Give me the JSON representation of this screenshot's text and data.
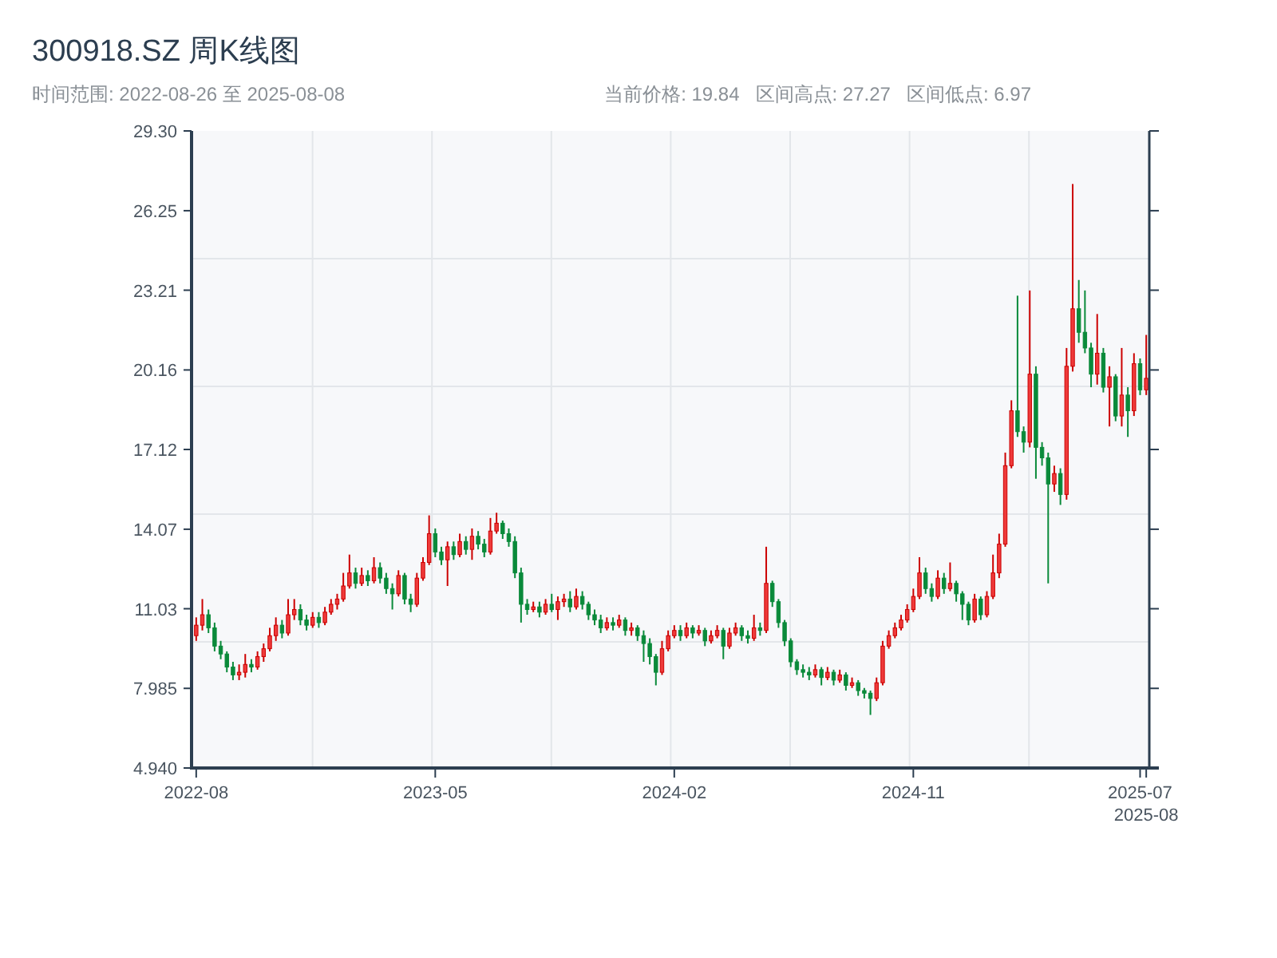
{
  "title": "300918.SZ 周K线图",
  "range_text": "时间范围: 2022-08-26 至 2025-08-08",
  "stats": [
    "当前价格: 19.84",
    "区间高点: 27.27",
    "区间低点: 6.97"
  ],
  "chart_data": {
    "type": "candlestick",
    "ylim": [
      4.94,
      29.3
    ],
    "yticks": [
      {
        "value": 4.94,
        "label": "4.940"
      },
      {
        "value": 7.985,
        "label": "7.985"
      },
      {
        "value": 11.03,
        "label": "11.03"
      },
      {
        "value": 14.07,
        "label": "14.07"
      },
      {
        "value": 17.12,
        "label": "17.12"
      },
      {
        "value": 20.16,
        "label": "20.16"
      },
      {
        "value": 23.21,
        "label": "23.21"
      },
      {
        "value": 26.25,
        "label": "26.25"
      },
      {
        "value": 29.3,
        "label": "29.30"
      }
    ],
    "categories": [
      "2022-08",
      null,
      null,
      null,
      null,
      null,
      null,
      null,
      null,
      null,
      null,
      null,
      null,
      null,
      null,
      null,
      null,
      null,
      null,
      null,
      null,
      null,
      null,
      null,
      null,
      null,
      null,
      null,
      null,
      null,
      null,
      null,
      null,
      null,
      null,
      null,
      null,
      null,
      null,
      "2023-05",
      null,
      null,
      null,
      null,
      null,
      null,
      null,
      null,
      null,
      null,
      null,
      null,
      null,
      null,
      null,
      null,
      null,
      null,
      null,
      null,
      null,
      null,
      null,
      null,
      null,
      null,
      null,
      null,
      null,
      null,
      null,
      null,
      null,
      null,
      null,
      null,
      null,
      null,
      "2024-02",
      null,
      null,
      null,
      null,
      null,
      null,
      null,
      null,
      null,
      null,
      null,
      null,
      null,
      null,
      null,
      null,
      null,
      null,
      null,
      null,
      null,
      null,
      null,
      null,
      null,
      null,
      null,
      null,
      null,
      null,
      null,
      null,
      null,
      null,
      null,
      null,
      null,
      null,
      "2024-11",
      null,
      null,
      null,
      null,
      null,
      null,
      null,
      null,
      null,
      null,
      null,
      null,
      null,
      null,
      null,
      null,
      null,
      null,
      null,
      null,
      null,
      null,
      null,
      null,
      null,
      null,
      null,
      null,
      null,
      null,
      null,
      null,
      null,
      null,
      null,
      null,
      "2025-07",
      "2025-08"
    ],
    "ohlc": [
      [
        10.0,
        10.7,
        9.8,
        10.4
      ],
      [
        10.4,
        11.4,
        10.2,
        10.8
      ],
      [
        10.8,
        11.0,
        10.1,
        10.3
      ],
      [
        10.3,
        10.5,
        9.4,
        9.6
      ],
      [
        9.6,
        9.8,
        9.1,
        9.3
      ],
      [
        9.3,
        9.4,
        8.6,
        8.8
      ],
      [
        8.8,
        9.0,
        8.3,
        8.5
      ],
      [
        8.5,
        8.9,
        8.3,
        8.6
      ],
      [
        8.6,
        9.3,
        8.4,
        8.9
      ],
      [
        8.9,
        9.1,
        8.6,
        8.8
      ],
      [
        8.8,
        9.4,
        8.7,
        9.2
      ],
      [
        9.2,
        9.7,
        9.0,
        9.5
      ],
      [
        9.5,
        10.3,
        9.4,
        10.0
      ],
      [
        10.0,
        10.7,
        9.8,
        10.4
      ],
      [
        10.4,
        10.6,
        9.9,
        10.1
      ],
      [
        10.1,
        11.4,
        10.0,
        10.8
      ],
      [
        10.8,
        11.4,
        10.6,
        11.0
      ],
      [
        11.0,
        11.2,
        10.4,
        10.6
      ],
      [
        10.6,
        10.8,
        10.2,
        10.4
      ],
      [
        10.4,
        10.9,
        10.3,
        10.7
      ],
      [
        10.7,
        10.9,
        10.3,
        10.5
      ],
      [
        10.5,
        11.1,
        10.4,
        10.9
      ],
      [
        10.9,
        11.4,
        10.8,
        11.2
      ],
      [
        11.2,
        11.6,
        11.0,
        11.4
      ],
      [
        11.4,
        12.4,
        11.3,
        11.9
      ],
      [
        11.9,
        13.1,
        11.8,
        12.4
      ],
      [
        12.4,
        12.6,
        11.8,
        12.0
      ],
      [
        12.0,
        12.6,
        11.9,
        12.3
      ],
      [
        12.3,
        12.5,
        11.9,
        12.1
      ],
      [
        12.1,
        13.0,
        12.0,
        12.6
      ],
      [
        12.6,
        12.8,
        12.0,
        12.2
      ],
      [
        12.2,
        12.4,
        11.6,
        11.8
      ],
      [
        11.8,
        12.0,
        11.0,
        11.6
      ],
      [
        11.6,
        12.5,
        11.5,
        12.3
      ],
      [
        12.3,
        12.4,
        11.2,
        11.4
      ],
      [
        11.4,
        11.6,
        10.9,
        11.2
      ],
      [
        11.2,
        12.4,
        11.1,
        12.2
      ],
      [
        12.2,
        13.0,
        12.1,
        12.8
      ],
      [
        12.8,
        14.6,
        12.7,
        13.9
      ],
      [
        13.9,
        14.1,
        13.0,
        13.2
      ],
      [
        13.2,
        13.4,
        12.7,
        12.9
      ],
      [
        12.9,
        13.6,
        11.9,
        13.4
      ],
      [
        13.4,
        13.6,
        12.9,
        13.1
      ],
      [
        13.1,
        13.9,
        13.0,
        13.6
      ],
      [
        13.6,
        13.8,
        13.1,
        13.3
      ],
      [
        13.3,
        14.1,
        12.9,
        13.8
      ],
      [
        13.8,
        14.0,
        13.3,
        13.5
      ],
      [
        13.5,
        13.7,
        13.0,
        13.2
      ],
      [
        13.2,
        14.5,
        13.1,
        14.0
      ],
      [
        14.0,
        14.7,
        13.9,
        14.3
      ],
      [
        14.3,
        14.4,
        13.7,
        13.9
      ],
      [
        13.9,
        14.1,
        13.4,
        13.6
      ],
      [
        13.6,
        13.8,
        12.2,
        12.4
      ],
      [
        12.4,
        12.6,
        10.5,
        11.2
      ],
      [
        11.2,
        11.4,
        10.8,
        11.0
      ],
      [
        11.0,
        11.3,
        10.9,
        11.1
      ],
      [
        11.1,
        11.3,
        10.7,
        10.9
      ],
      [
        10.9,
        11.4,
        10.8,
        11.2
      ],
      [
        11.2,
        11.6,
        10.9,
        11.0
      ],
      [
        11.0,
        11.5,
        10.6,
        11.3
      ],
      [
        11.3,
        11.6,
        11.1,
        11.4
      ],
      [
        11.4,
        11.7,
        10.9,
        11.1
      ],
      [
        11.1,
        11.8,
        11.0,
        11.5
      ],
      [
        11.5,
        11.7,
        11.0,
        11.2
      ],
      [
        11.2,
        11.3,
        10.6,
        10.8
      ],
      [
        10.8,
        11.0,
        10.4,
        10.6
      ],
      [
        10.6,
        10.8,
        10.1,
        10.3
      ],
      [
        10.3,
        10.7,
        10.2,
        10.5
      ],
      [
        10.5,
        10.7,
        10.2,
        10.4
      ],
      [
        10.4,
        10.8,
        10.3,
        10.6
      ],
      [
        10.6,
        10.7,
        10.0,
        10.2
      ],
      [
        10.2,
        10.5,
        10.0,
        10.3
      ],
      [
        10.3,
        10.4,
        9.8,
        10.0
      ],
      [
        10.0,
        10.2,
        9.0,
        9.7
      ],
      [
        9.7,
        9.9,
        8.9,
        9.2
      ],
      [
        9.2,
        9.3,
        8.1,
        8.6
      ],
      [
        8.6,
        9.8,
        8.5,
        9.5
      ],
      [
        9.5,
        10.2,
        9.4,
        10.0
      ],
      [
        10.0,
        10.4,
        9.9,
        10.2
      ],
      [
        10.2,
        10.4,
        9.8,
        10.0
      ],
      [
        10.0,
        10.5,
        9.9,
        10.3
      ],
      [
        10.3,
        10.4,
        9.9,
        10.1
      ],
      [
        10.1,
        10.4,
        10.0,
        10.2
      ],
      [
        10.2,
        10.3,
        9.6,
        9.8
      ],
      [
        9.8,
        10.2,
        9.7,
        10.0
      ],
      [
        10.0,
        10.4,
        9.9,
        10.2
      ],
      [
        10.2,
        10.3,
        9.1,
        9.6
      ],
      [
        9.6,
        10.3,
        9.5,
        10.1
      ],
      [
        10.1,
        10.5,
        10.0,
        10.3
      ],
      [
        10.3,
        10.4,
        9.8,
        10.0
      ],
      [
        10.0,
        10.2,
        9.7,
        9.9
      ],
      [
        9.9,
        10.8,
        9.8,
        10.3
      ],
      [
        10.3,
        10.5,
        10.0,
        10.2
      ],
      [
        10.2,
        13.4,
        10.1,
        12.0
      ],
      [
        12.0,
        12.1,
        11.1,
        11.3
      ],
      [
        11.3,
        11.4,
        10.3,
        10.5
      ],
      [
        10.5,
        10.6,
        9.6,
        9.8
      ],
      [
        9.8,
        9.9,
        8.8,
        9.0
      ],
      [
        9.0,
        9.1,
        8.5,
        8.7
      ],
      [
        8.7,
        8.9,
        8.4,
        8.6
      ],
      [
        8.6,
        8.8,
        8.3,
        8.5
      ],
      [
        8.5,
        8.9,
        8.4,
        8.7
      ],
      [
        8.7,
        8.8,
        8.1,
        8.4
      ],
      [
        8.4,
        8.8,
        8.3,
        8.6
      ],
      [
        8.6,
        8.7,
        8.1,
        8.3
      ],
      [
        8.3,
        8.7,
        8.2,
        8.5
      ],
      [
        8.5,
        8.6,
        7.9,
        8.1
      ],
      [
        8.1,
        8.4,
        8.0,
        8.2
      ],
      [
        8.2,
        8.3,
        7.7,
        7.9
      ],
      [
        7.9,
        8.0,
        7.6,
        7.8
      ],
      [
        7.8,
        7.9,
        6.97,
        7.6
      ],
      [
        7.6,
        8.4,
        7.5,
        8.2
      ],
      [
        8.2,
        9.8,
        8.1,
        9.6
      ],
      [
        9.6,
        10.2,
        9.5,
        10.0
      ],
      [
        10.0,
        10.5,
        9.9,
        10.3
      ],
      [
        10.3,
        10.8,
        10.2,
        10.6
      ],
      [
        10.6,
        11.2,
        10.5,
        11.0
      ],
      [
        11.0,
        11.8,
        10.9,
        11.5
      ],
      [
        11.5,
        13.0,
        11.4,
        12.4
      ],
      [
        12.4,
        12.6,
        11.6,
        11.8
      ],
      [
        11.8,
        12.0,
        11.3,
        11.5
      ],
      [
        11.5,
        12.5,
        11.4,
        12.2
      ],
      [
        12.2,
        12.4,
        11.6,
        11.8
      ],
      [
        11.8,
        12.8,
        11.7,
        12.0
      ],
      [
        12.0,
        12.1,
        11.3,
        11.6
      ],
      [
        11.6,
        11.7,
        10.6,
        11.2
      ],
      [
        11.2,
        11.3,
        10.4,
        10.6
      ],
      [
        10.6,
        11.6,
        10.5,
        11.4
      ],
      [
        11.4,
        11.5,
        10.6,
        10.8
      ],
      [
        10.8,
        11.7,
        10.7,
        11.5
      ],
      [
        11.5,
        13.1,
        11.4,
        12.4
      ],
      [
        12.4,
        13.9,
        12.2,
        13.5
      ],
      [
        13.5,
        17.0,
        13.4,
        16.5
      ],
      [
        16.5,
        19.0,
        16.4,
        18.6
      ],
      [
        18.6,
        23.0,
        17.6,
        17.8
      ],
      [
        17.8,
        18.0,
        17.0,
        17.4
      ],
      [
        17.4,
        23.2,
        17.2,
        20.0
      ],
      [
        20.0,
        20.3,
        16.0,
        17.2
      ],
      [
        17.2,
        17.4,
        16.5,
        16.8
      ],
      [
        16.8,
        17.0,
        12.0,
        15.8
      ],
      [
        15.8,
        16.5,
        15.5,
        16.2
      ],
      [
        16.2,
        16.4,
        15.0,
        15.4
      ],
      [
        15.4,
        21.0,
        15.2,
        20.3
      ],
      [
        20.3,
        27.27,
        20.1,
        22.5
      ],
      [
        22.5,
        23.6,
        21.2,
        21.6
      ],
      [
        21.6,
        23.2,
        20.8,
        21.0
      ],
      [
        21.0,
        21.2,
        19.5,
        20.0
      ],
      [
        20.0,
        22.3,
        19.6,
        20.8
      ],
      [
        20.8,
        21.0,
        19.3,
        19.5
      ],
      [
        19.5,
        20.3,
        18.0,
        19.9
      ],
      [
        19.9,
        20.0,
        18.2,
        18.4
      ],
      [
        18.4,
        21.0,
        18.0,
        19.2
      ],
      [
        19.2,
        19.5,
        17.6,
        18.6
      ],
      [
        18.6,
        20.8,
        18.4,
        20.4
      ],
      [
        20.4,
        20.6,
        19.2,
        19.4
      ],
      [
        19.4,
        21.5,
        19.2,
        19.84
      ]
    ]
  }
}
